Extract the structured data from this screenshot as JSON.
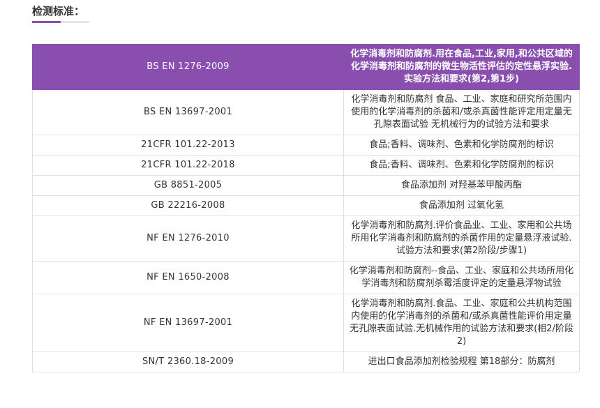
{
  "section": {
    "title": "检测标准："
  },
  "colors": {
    "accent": "#8a4fae",
    "border": "#e0e0e0",
    "text": "#333333"
  },
  "table": {
    "header": {
      "code": "BS EN 1276-2009",
      "name": "化学消毒剂和防腐剂.用在食品,工业,家用,和公共区域的化学消毒剂和防腐剂的微生物活性评估的定性悬浮实验.实验方法和要求(第2,第1步)"
    },
    "rows": [
      {
        "code": "BS EN 13697-2001",
        "name": "化学消毒剂和防腐剂 食品、工业、家庭和研究所范围内使用的化学消毒剂的杀菌和/或杀真菌性能评定用定量无孔隙表面试验 无机械行为的试验方法和要求"
      },
      {
        "code": "21CFR 101.22-2013",
        "name": "食品;香料、调味剂、色素和化学防腐剂的标识"
      },
      {
        "code": "21CFR 101.22-2018",
        "name": "食品;香料、调味剂、色素和化学防腐剂的标识"
      },
      {
        "code": "GB 8851-2005",
        "name": "食品添加剂 对羟基苯甲酸丙酯"
      },
      {
        "code": "GB 22216-2008",
        "name": "食品添加剂 过氧化氢"
      },
      {
        "code": "NF EN 1276-2010",
        "name": "化学消毒剂和防腐剂.评价食品业、工业、家用和公共场所用化学消毒剂和防腐剂的杀菌作用的定量悬浮液试验.试验方法和要求(第2阶段/步骤1)"
      },
      {
        "code": "NF EN 1650-2008",
        "name": "化学消毒剂和防腐剂--食品、工业、家庭和公共场所用化学消毒剂和防腐剂杀霉活度评定的定量悬浮物试验"
      },
      {
        "code": "NF EN 13697-2001",
        "name": "化学消毒剂和防腐剂.食品、工业、家庭和公共机构范围内使用的化学消毒剂的杀菌和/或杀真菌性能评价用定量无孔隙表面试验.无机械作用的试验方法和要求(相2/阶段2)"
      },
      {
        "code": "SN/T 2360.18-2009",
        "name": "进出口食品添加剂检验规程 第18部分：防腐剂"
      }
    ]
  }
}
